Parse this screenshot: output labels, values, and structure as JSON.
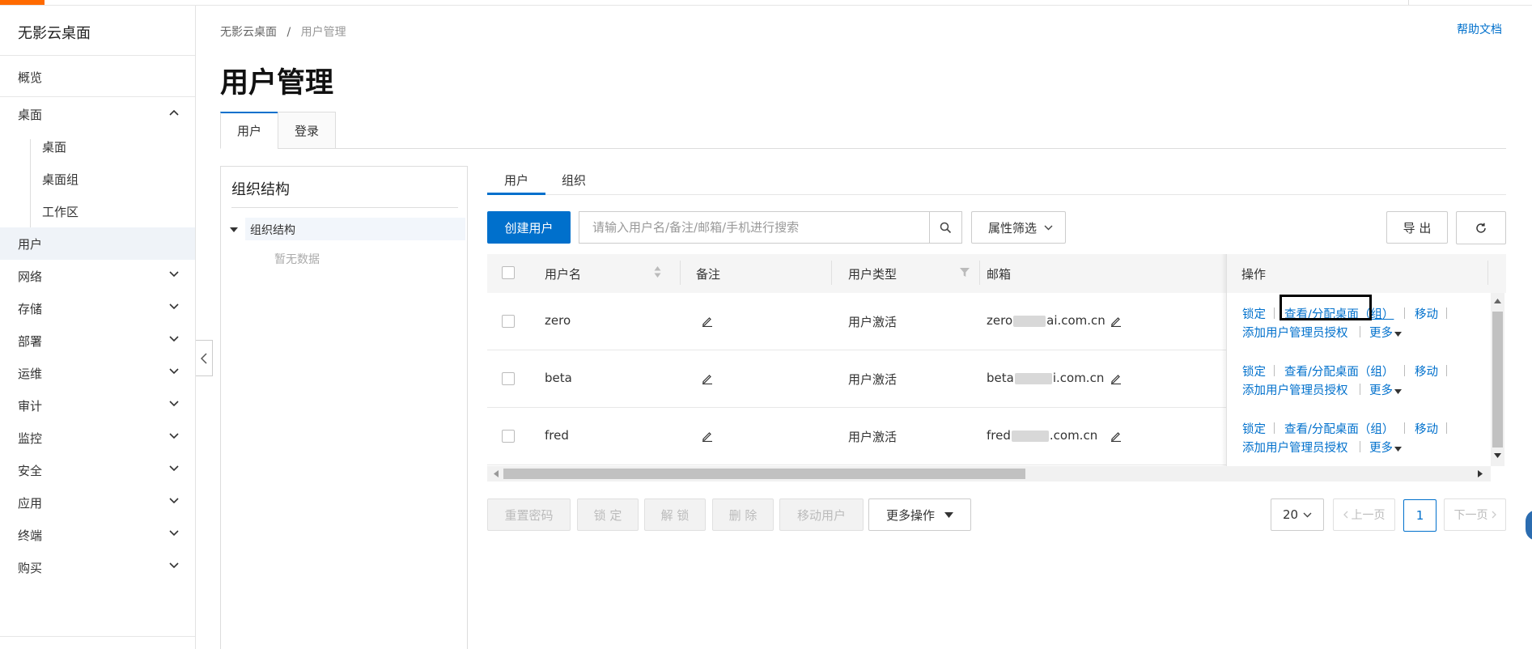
{
  "app": {
    "brand": "无影云桌面",
    "help_link": "帮助文档"
  },
  "breadcrumb": {
    "root": "无影云桌面",
    "separator": "/",
    "current": "用户管理"
  },
  "page_title": "用户管理",
  "sidebar": {
    "items": [
      {
        "label": "概览"
      },
      {
        "label": "桌面",
        "expanded": true
      },
      {
        "label": "桌面"
      },
      {
        "label": "桌面组"
      },
      {
        "label": "工作区"
      },
      {
        "label": "用户",
        "active": true
      },
      {
        "label": "网络"
      },
      {
        "label": "存储"
      },
      {
        "label": "部署"
      },
      {
        "label": "运维"
      },
      {
        "label": "审计"
      },
      {
        "label": "监控"
      },
      {
        "label": "安全"
      },
      {
        "label": "应用"
      },
      {
        "label": "终端"
      },
      {
        "label": "购买"
      }
    ]
  },
  "main_tabs": [
    {
      "label": "用户",
      "active": true
    },
    {
      "label": "登录"
    }
  ],
  "org_panel": {
    "title": "组织结构",
    "root_node": "组织结构",
    "empty_text": "暂无数据"
  },
  "sub_tabs": [
    {
      "label": "用户",
      "active": true
    },
    {
      "label": "组织"
    }
  ],
  "toolbar": {
    "create_user": "创建用户",
    "search_placeholder": "请输入用户名/备注/邮箱/手机进行搜索",
    "attribute_filter": "属性筛选",
    "export": "导 出"
  },
  "table": {
    "columns": {
      "username": "用户名",
      "remark": "备注",
      "user_type": "用户类型",
      "email": "邮箱",
      "actions": "操作"
    },
    "rows": [
      {
        "username": "zero",
        "user_type": "用户激活",
        "email_prefix": "zero",
        "email_suffix": "ai.com.cn"
      },
      {
        "username": "beta",
        "user_type": "用户激活",
        "email_prefix": "beta",
        "email_suffix": "i.com.cn"
      },
      {
        "username": "fred",
        "user_type": "用户激活",
        "email_prefix": "fred",
        "email_suffix": ".com.cn"
      }
    ],
    "row_actions": {
      "lock": "锁定",
      "view_assign": "查看/分配桌面（组）",
      "view_assign_first": "查看/分配桌面",
      "view_assign_rest": "（组）",
      "move": "移动",
      "add_admin": "添加用户管理员授权",
      "more": "更多"
    }
  },
  "bulk_actions": {
    "reset_password": "重置密码",
    "lock": "锁 定",
    "unlock": "解 锁",
    "delete": "删 除",
    "move_user": "移动用户",
    "more_ops": "更多操作"
  },
  "pagination": {
    "page_size": "20",
    "prev": "上一页",
    "current_page": "1",
    "next": "下一页"
  },
  "colors": {
    "accent": "#0070cc",
    "brand_orange": "#ff6a00",
    "highlight_box": "#000000"
  }
}
